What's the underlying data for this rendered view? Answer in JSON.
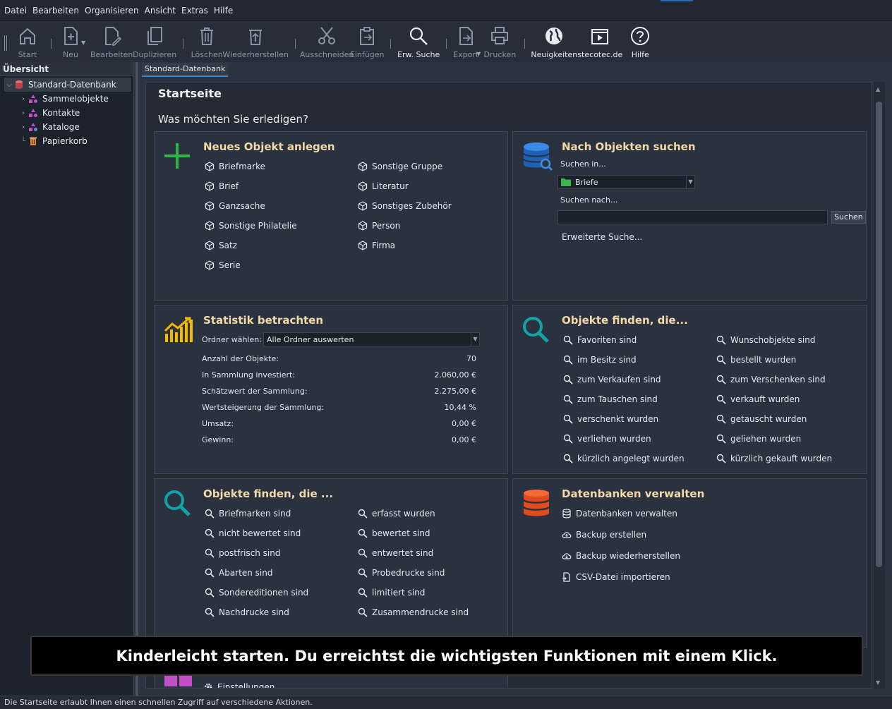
{
  "menu": [
    "Datei",
    "Bearbeiten",
    "Organisieren",
    "Ansicht",
    "Extras",
    "Hilfe"
  ],
  "toolbar": {
    "start": "Start",
    "new": "Neu",
    "edit": "Bearbeiten",
    "duplicate": "Duplizieren",
    "delete": "Löschen",
    "restore": "Wiederherstellen",
    "cut": "Ausschneiden",
    "paste": "Einfügen",
    "adv_search": "Erw. Suche",
    "export": "Export",
    "print": "Drucken",
    "news": "Neuigkeiten",
    "website": "stecotec.de",
    "help": "Hilfe"
  },
  "sidebar": {
    "title": "Übersicht",
    "root": "Standard-Datenbank",
    "items": [
      "Sammelobjekte",
      "Kontakte",
      "Kataloge",
      "Papierkorb"
    ]
  },
  "tab": "Standard-Datenbank",
  "page": {
    "title": "Startseite",
    "subtitle": "Was möchten Sie erledigen?"
  },
  "new_object": {
    "title": "Neues Objekt anlegen",
    "left": [
      "Briefmarke",
      "Brief",
      "Ganzsache",
      "Sonstige Philatelie",
      "Satz",
      "Serie"
    ],
    "right": [
      "Sonstige Gruppe",
      "Literatur",
      "Sonstiges Zubehör",
      "Person",
      "Firma"
    ]
  },
  "search": {
    "title": "Nach Objekten suchen",
    "in_label": "Suchen in...",
    "in_value": "Briefe",
    "for_label": "Suchen nach...",
    "button": "Suchen",
    "advanced": "Erweiterte Suche..."
  },
  "stats": {
    "title": "Statistik betrachten",
    "folder_label": "Ordner wählen:",
    "folder_value": "Alle Ordner auswerten",
    "rows": [
      {
        "label": "Anzahl der Objekte:",
        "value": "70"
      },
      {
        "label": "In Sammlung investiert:",
        "value": "2.060,00 €"
      },
      {
        "label": "Schätzwert der Sammlung:",
        "value": "2.275,00 €"
      },
      {
        "label": "Wertsteigerung der Sammlung:",
        "value": "10,44 %"
      },
      {
        "label": "Umsatz:",
        "value": "0,00 €"
      },
      {
        "label": "Gewinn:",
        "value": "0,00 €"
      }
    ]
  },
  "find1": {
    "title": "Objekte finden, die...",
    "left": [
      "Favoriten sind",
      "im Besitz sind",
      "zum Verkaufen sind",
      "zum Tauschen sind",
      "verschenkt wurden",
      "verliehen wurden",
      "kürzlich angelegt wurden"
    ],
    "right": [
      "Wunschobjekte sind",
      "bestellt wurden",
      "zum Verschenken sind",
      "verkauft wurden",
      "getauscht wurden",
      "geliehen wurden",
      "kürzlich gekauft wurden"
    ]
  },
  "find2": {
    "title": "Objekte finden, die ...",
    "left": [
      "Briefmarken sind",
      "nicht bewertet sind",
      "postfrisch sind",
      "Abarten sind",
      "Sondereditionen sind",
      "Nachdrucke sind"
    ],
    "right": [
      "erfasst wurden",
      "bewertet sind",
      "entwertet sind",
      "Probedrucke sind",
      "limitiert sind",
      "Zusammendrucke sind"
    ]
  },
  "db": {
    "title": "Datenbanken verwalten",
    "items": [
      "Datenbanken verwalten",
      "Backup erstellen",
      "Backup wiederherstellen",
      "CSV-Datei importieren"
    ]
  },
  "settings_partial": "Einstellungen",
  "caption": "Kinderleicht starten. Du erreichtst die wichtigsten Funktionen mit einem Klick.",
  "status": "Die Startseite erlaubt Ihnen einen schnellen Zugriff auf verschiedene Aktionen.",
  "colors": {
    "accent": "#2d6bb5",
    "card_title": "#f2d9a8",
    "plus": "#2fb344",
    "stats": "#f5b800",
    "search_teal": "#13a3a7",
    "db_orange": "#f05a28",
    "cube_purple": "#c24fc8"
  }
}
